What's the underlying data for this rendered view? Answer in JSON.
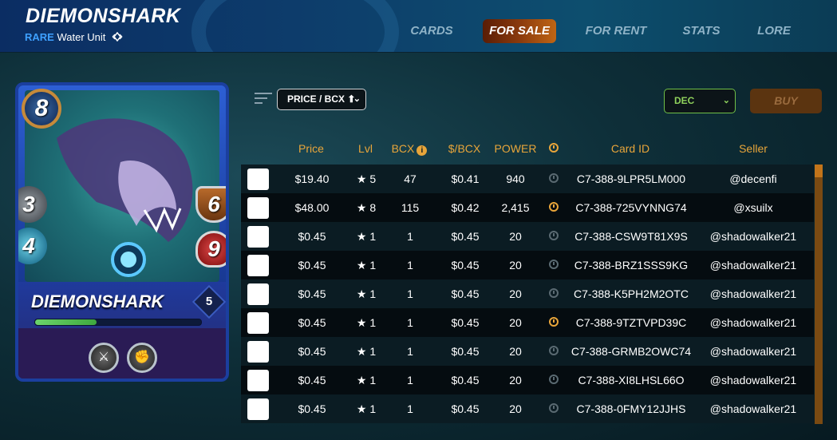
{
  "header": {
    "title": "DIEMONSHARK",
    "rarity": "RARE",
    "unit_type": "Water Unit"
  },
  "tabs": [
    {
      "label": "CARDS",
      "active": false
    },
    {
      "label": "FOR SALE",
      "active": true
    },
    {
      "label": "FOR RENT",
      "active": false
    },
    {
      "label": "STATS",
      "active": false
    },
    {
      "label": "LORE",
      "active": false
    }
  ],
  "card": {
    "name": "DIEMONSHARK",
    "mana": "8",
    "attack": "3",
    "speed": "4",
    "armor": "6",
    "health": "9",
    "level": "5",
    "xp_fraction": 0.37
  },
  "controls": {
    "sort_label": "PRICE / BCX ⬆",
    "currency": "DEC",
    "buy_label": "BUY"
  },
  "table": {
    "headers": {
      "price": "Price",
      "lvl": "Lvl",
      "bcx": "BCX",
      "per_bcx": "$/BCX",
      "power": "POWER",
      "card_id": "Card ID",
      "seller": "Seller"
    },
    "rows": [
      {
        "price": "$19.40",
        "lvl": "★ 5",
        "bcx": "47",
        "per_bcx": "$0.41",
        "power": "940",
        "clock": "dim",
        "card_id": "C7-388-9LPR5LM000",
        "seller": "@decenfi"
      },
      {
        "price": "$48.00",
        "lvl": "★ 8",
        "bcx": "115",
        "per_bcx": "$0.42",
        "power": "2,415",
        "clock": "active",
        "card_id": "C7-388-725VYNNG74",
        "seller": "@xsuilx"
      },
      {
        "price": "$0.45",
        "lvl": "★ 1",
        "bcx": "1",
        "per_bcx": "$0.45",
        "power": "20",
        "clock": "dim",
        "card_id": "C7-388-CSW9T81X9S",
        "seller": "@shadowalker21"
      },
      {
        "price": "$0.45",
        "lvl": "★ 1",
        "bcx": "1",
        "per_bcx": "$0.45",
        "power": "20",
        "clock": "dim",
        "card_id": "C7-388-BRZ1SSS9KG",
        "seller": "@shadowalker21"
      },
      {
        "price": "$0.45",
        "lvl": "★ 1",
        "bcx": "1",
        "per_bcx": "$0.45",
        "power": "20",
        "clock": "dim",
        "card_id": "C7-388-K5PH2M2OTC",
        "seller": "@shadowalker21"
      },
      {
        "price": "$0.45",
        "lvl": "★ 1",
        "bcx": "1",
        "per_bcx": "$0.45",
        "power": "20",
        "clock": "active",
        "card_id": "C7-388-9TZTVPD39C",
        "seller": "@shadowalker21"
      },
      {
        "price": "$0.45",
        "lvl": "★ 1",
        "bcx": "1",
        "per_bcx": "$0.45",
        "power": "20",
        "clock": "dim",
        "card_id": "C7-388-GRMB2OWC74",
        "seller": "@shadowalker21"
      },
      {
        "price": "$0.45",
        "lvl": "★ 1",
        "bcx": "1",
        "per_bcx": "$0.45",
        "power": "20",
        "clock": "dim",
        "card_id": "C7-388-XI8LHSL66O",
        "seller": "@shadowalker21"
      },
      {
        "price": "$0.45",
        "lvl": "★ 1",
        "bcx": "1",
        "per_bcx": "$0.45",
        "power": "20",
        "clock": "dim",
        "card_id": "C7-388-0FMY12JJHS",
        "seller": "@shadowalker21"
      }
    ]
  },
  "colors": {
    "accent": "#e8a53a",
    "rare": "#3ea0ff",
    "currency_border": "#6fbf47",
    "buy_bg": "#5b3410"
  }
}
